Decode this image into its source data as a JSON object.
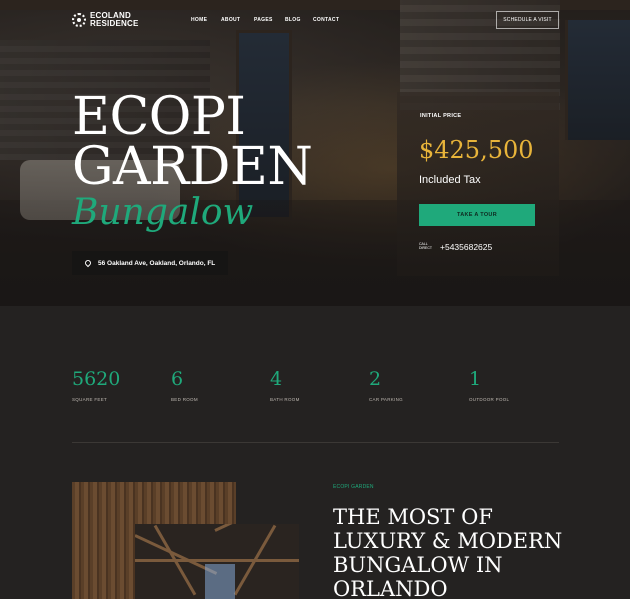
{
  "brand": {
    "line1": "ECOLAND",
    "line2": "RESIDENCE"
  },
  "nav": {
    "items": [
      "HOME",
      "ABOUT",
      "PAGES",
      "BLOG",
      "CONTACT"
    ],
    "cta": "SCHEDULE A VISIT"
  },
  "hero": {
    "title_line1": "ECOPI",
    "title_line2": "GARDEN",
    "script": "Bungalow",
    "address": "56 Oakland Ave, Oakland, Orlando, FL"
  },
  "price_card": {
    "label": "INITIAL PRICE",
    "price": "$425,500",
    "tax": "Included Tax",
    "button": "TAKE A TOUR",
    "call_label": "CALL DIRECT",
    "phone": "+5435682625"
  },
  "stats": [
    {
      "value": "5620",
      "label": "SQUARE FEET"
    },
    {
      "value": "6",
      "label": "BED ROOM"
    },
    {
      "value": "4",
      "label": "BATH ROOM"
    },
    {
      "value": "2",
      "label": "CAR PARKING"
    },
    {
      "value": "1",
      "label": "OUTDOOR POOL"
    }
  ],
  "about": {
    "tagline": "ECOPI GARDEN",
    "heading": "THE MOST OF LUXURY & MODERN BUNGALOW IN ORLANDO"
  },
  "colors": {
    "accent": "#1fa97b",
    "price": "#e8b43a",
    "background": "#242221"
  }
}
